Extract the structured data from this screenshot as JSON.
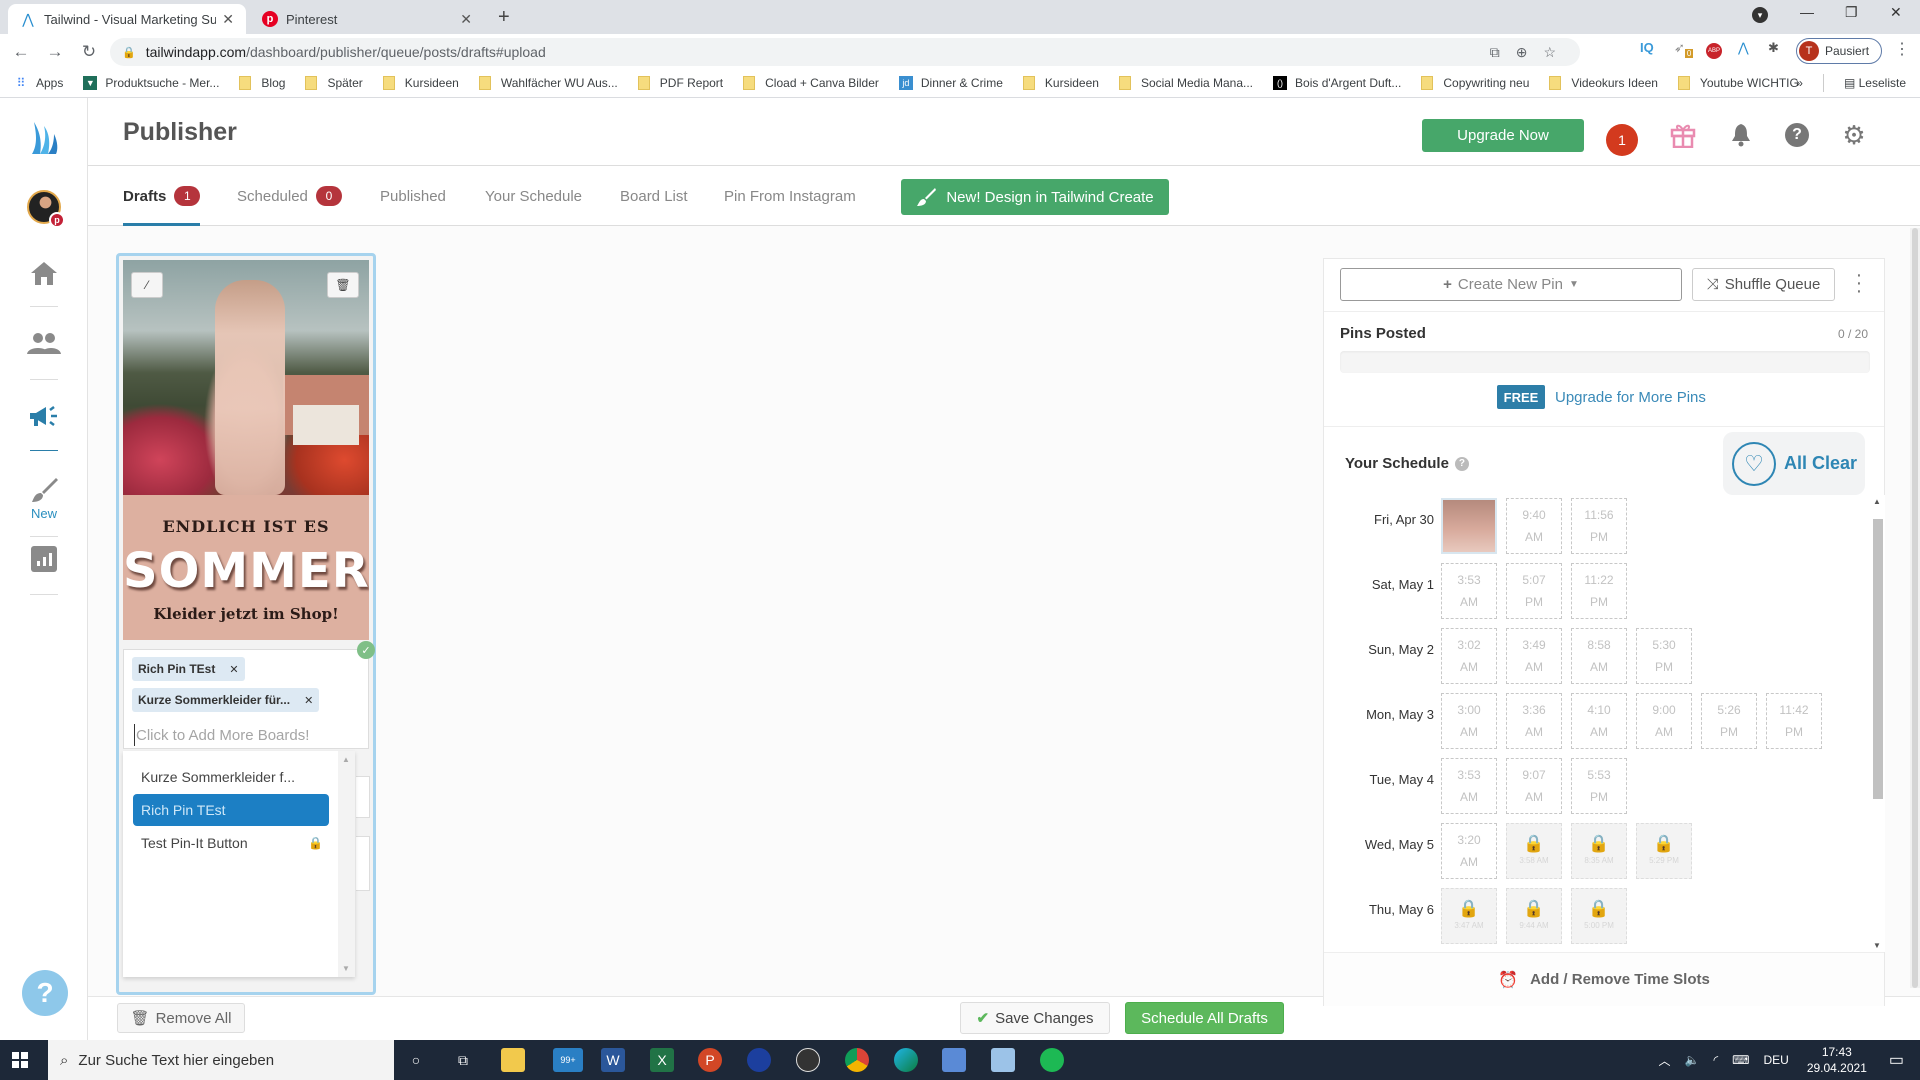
{
  "browser": {
    "tabs": [
      {
        "title": "Tailwind - Visual Marketing Suite",
        "active": true,
        "icon": "tailwind-icon"
      },
      {
        "title": "Pinterest",
        "active": false,
        "icon": "pinterest-icon"
      }
    ],
    "url_host": "tailwindapp.com",
    "url_path": "/dashboard/publisher/queue/posts/drafts#upload",
    "profile_initial": "T",
    "profile_status": "Pausiert",
    "extension_badge": "0",
    "bookmarks": [
      {
        "label": "Apps",
        "icon": "apps-grid-icon"
      },
      {
        "label": "Produktsuche - Mer...",
        "icon": "shirt-icon"
      },
      {
        "label": "Blog",
        "icon": "folder-icon"
      },
      {
        "label": "Später",
        "icon": "folder-icon"
      },
      {
        "label": "Kursideen",
        "icon": "folder-icon"
      },
      {
        "label": "Wahlfächer WU Aus...",
        "icon": "folder-icon"
      },
      {
        "label": "PDF Report",
        "icon": "folder-icon"
      },
      {
        "label": "Cload + Canva Bilder",
        "icon": "folder-icon"
      },
      {
        "label": "Dinner & Crime",
        "icon": "jd-icon"
      },
      {
        "label": "Kursideen",
        "icon": "folder-icon"
      },
      {
        "label": "Social Media Mana...",
        "icon": "folder-icon"
      },
      {
        "label": "Bois d'Argent Duft...",
        "icon": "brand-icon"
      },
      {
        "label": "Copywriting neu",
        "icon": "folder-icon"
      },
      {
        "label": "Videokurs Ideen",
        "icon": "folder-icon"
      },
      {
        "label": "Youtube WICHTIG",
        "icon": "folder-icon"
      }
    ],
    "bookmarks_more": "»",
    "reading_list": "Leseliste"
  },
  "sidebar": {
    "items": [
      {
        "name": "logo",
        "icon": "tailwind-logo-icon"
      },
      {
        "name": "account",
        "icon": "avatar-icon"
      },
      {
        "name": "home",
        "icon": "home-icon"
      },
      {
        "name": "communities",
        "icon": "people-icon"
      },
      {
        "name": "publisher",
        "icon": "megaphone-icon",
        "active": true
      },
      {
        "name": "create",
        "icon": "brush-icon",
        "label": "New"
      },
      {
        "name": "insights",
        "icon": "chart-icon"
      }
    ]
  },
  "header": {
    "title": "Publisher",
    "upgrade_label": "Upgrade Now",
    "notification_count": "1"
  },
  "tabs": [
    {
      "label": "Drafts",
      "badge": "1",
      "active": true
    },
    {
      "label": "Scheduled",
      "badge": "0"
    },
    {
      "label": "Published"
    },
    {
      "label": "Your Schedule"
    },
    {
      "label": "Board List"
    },
    {
      "label": "Pin From Instagram"
    }
  ],
  "create_button_label": "New! Design in Tailwind Create",
  "pin_card": {
    "image_text": {
      "line1": "ENDLICH IST ES",
      "line2": "SOMMER",
      "line3": "Kleider jetzt im Shop!"
    },
    "selected_boards": [
      "Rich Pin TEst",
      "Kurze Sommerkleider für..."
    ],
    "board_input_placeholder": "Click to Add More Boards!",
    "dropdown_options": [
      {
        "label": "Kurze Sommerkleider f...",
        "selected": false,
        "locked": false
      },
      {
        "label": "Rich Pin TEst",
        "selected": true,
        "locked": false
      },
      {
        "label": "Test Pin-It Button",
        "selected": false,
        "locked": true
      }
    ]
  },
  "bottom_bar": {
    "remove_all": "Remove All",
    "save_changes": "Save Changes",
    "schedule_all": "Schedule All Drafts"
  },
  "right_panel": {
    "create_new_pin": "Create New Pin",
    "shuffle_queue": "Shuffle Queue",
    "pins_posted_label": "Pins Posted",
    "pins_posted_count": "0 / 20",
    "pins_posted_fraction": 0,
    "free_badge": "FREE",
    "upgrade_link": "Upgrade for More Pins",
    "schedule_title": "Your Schedule",
    "all_clear": "All Clear",
    "add_remove_slots": "Add / Remove Time Slots",
    "days": [
      {
        "label": "Fri, Apr 30",
        "slots": [
          {
            "filled": true
          },
          {
            "time": "9:40",
            "ampm": "AM"
          },
          {
            "time": "11:56",
            "ampm": "PM"
          }
        ]
      },
      {
        "label": "Sat, May 1",
        "slots": [
          {
            "time": "3:53",
            "ampm": "AM"
          },
          {
            "time": "5:07",
            "ampm": "PM"
          },
          {
            "time": "11:22",
            "ampm": "PM"
          }
        ]
      },
      {
        "label": "Sun, May 2",
        "slots": [
          {
            "time": "3:02",
            "ampm": "AM"
          },
          {
            "time": "3:49",
            "ampm": "AM"
          },
          {
            "time": "8:58",
            "ampm": "AM"
          },
          {
            "time": "5:30",
            "ampm": "PM"
          }
        ]
      },
      {
        "label": "Mon, May 3",
        "slots": [
          {
            "time": "3:00",
            "ampm": "AM"
          },
          {
            "time": "3:36",
            "ampm": "AM"
          },
          {
            "time": "4:10",
            "ampm": "AM"
          },
          {
            "time": "9:00",
            "ampm": "AM"
          },
          {
            "time": "5:26",
            "ampm": "PM"
          },
          {
            "time": "11:42",
            "ampm": "PM"
          }
        ]
      },
      {
        "label": "Tue, May 4",
        "slots": [
          {
            "time": "3:53",
            "ampm": "AM"
          },
          {
            "time": "9:07",
            "ampm": "AM"
          },
          {
            "time": "5:53",
            "ampm": "PM"
          }
        ]
      },
      {
        "label": "Wed, May 5",
        "slots": [
          {
            "time": "3:20",
            "ampm": "AM"
          },
          {
            "locked": true,
            "time_full": "3:58 AM"
          },
          {
            "locked": true,
            "time_full": "8:35 AM"
          },
          {
            "locked": true,
            "time_full": "5:29 PM"
          }
        ]
      },
      {
        "label": "Thu, May 6",
        "slots": [
          {
            "locked": true,
            "time_full": "3:47 AM"
          },
          {
            "locked": true,
            "time_full": "9:44 AM"
          },
          {
            "locked": true,
            "time_full": "5:00 PM"
          }
        ]
      }
    ]
  },
  "taskbar": {
    "search_placeholder": "Zur Suche Text hier eingeben",
    "mail_badge": "99+",
    "language": "DEU",
    "time": "17:43",
    "date": "29.04.2021"
  }
}
